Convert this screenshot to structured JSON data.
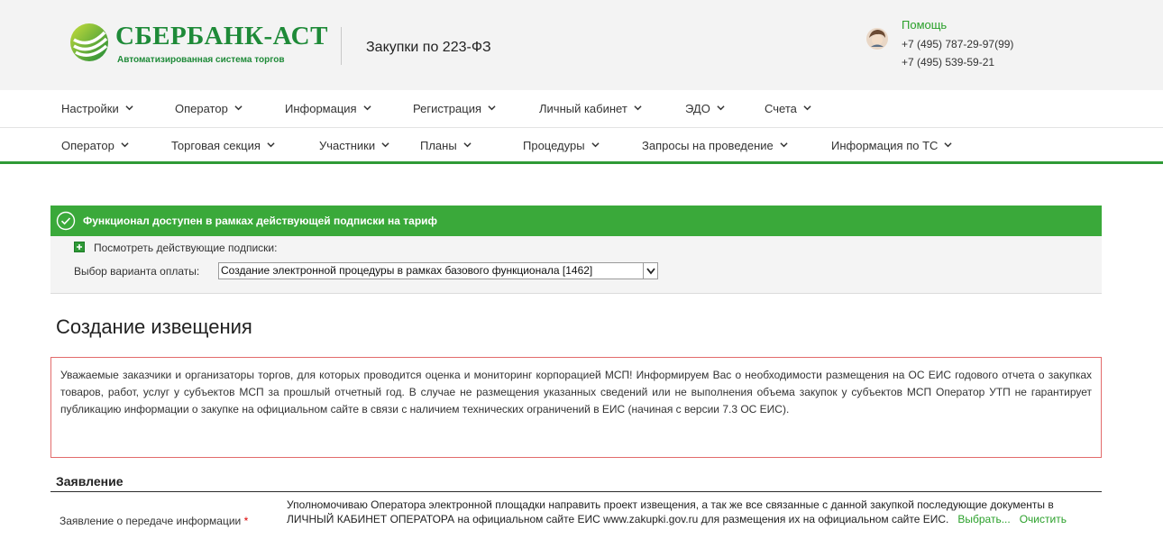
{
  "header": {
    "logo_name": "СБЕРБАНК-АСТ",
    "logo_sub": "Автоматизированная система торгов",
    "section": "Закупки по 223-ФЗ",
    "help_label": "Помощь",
    "phone1": "+7 (495) 787-29-97(99)",
    "phone2": "+7 (495) 539-59-21"
  },
  "nav_primary": [
    {
      "label": "Настройки"
    },
    {
      "label": "Оператор"
    },
    {
      "label": "Информация"
    },
    {
      "label": "Регистрация"
    },
    {
      "label": "Личный кабинет"
    },
    {
      "label": "ЭДО"
    },
    {
      "label": "Счета"
    }
  ],
  "nav_secondary": [
    {
      "label": "Оператор"
    },
    {
      "label": "Торговая секция"
    },
    {
      "label": "Участники"
    },
    {
      "label": "Планы"
    },
    {
      "label": "Процедуры"
    },
    {
      "label": "Запросы на проведение"
    },
    {
      "label": "Информация по ТС"
    }
  ],
  "subscription": {
    "banner": "Функционал доступен в рамках действующей подписки на тариф",
    "view_link": "Посмотреть действующие подписки:",
    "payment_label": "Выбор варианта оплаты:",
    "payment_value": "Создание электронной процедуры в рамках базового функционала [1462]"
  },
  "page": {
    "title": "Создание извещения",
    "notice": "Уважаемые заказчики и организаторы торгов, для которых проводится оценка и мониторинг корпорацией МСП! Информируем Вас о необходимости размещения на ОС ЕИС годового отчета о закупках товаров, работ, услуг у субъектов МСП за прошлый отчетный год. В случае не размещения указанных сведений или не выполнения объема закупок у субъектов МСП Оператор УТП не гарантирует публикацию информации о закупке на официальном сайте в связи с наличием технических ограничений в ЕИС (начиная с версии 7.3 ОС ЕИС)."
  },
  "statement": {
    "section_title": "Заявление",
    "field_label": "Заявление о передаче информации",
    "required_mark": "*",
    "field_text": "Уполномочиваю Оператора электронной площадки направить проект извещения, а так же все связанные с данной закупкой последующие документы в ЛИЧНЫЙ КАБИНЕТ ОПЕРАТОРА на официальном сайте ЕИС www.zakupki.gov.ru для размещения их на официальном сайте ЕИС.",
    "select_link": "Выбрать...",
    "clear_link": "Очистить"
  },
  "colors": {
    "brand_green": "#1e8a38",
    "banner_green": "#3aa93a",
    "nav_underline": "#2f9a36",
    "notice_border": "#e26b6b",
    "link_green": "#2aa02a"
  }
}
